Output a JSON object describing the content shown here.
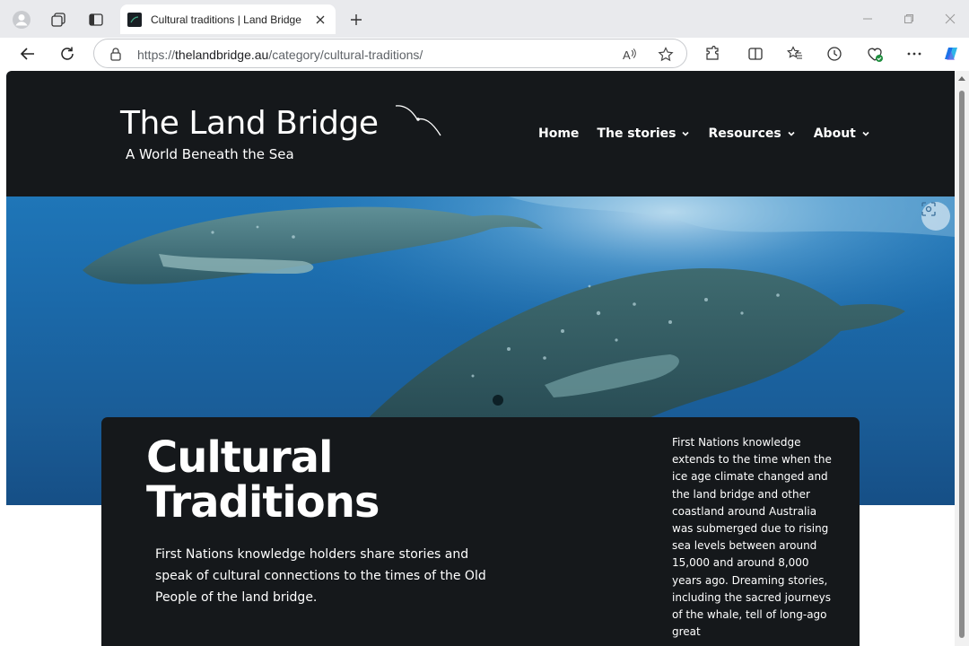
{
  "browser": {
    "tab_title": "Cultural traditions | Land Bridge",
    "url_prefix": "https://",
    "url_host": "thelandbridge.au",
    "url_path": "/category/cultural-traditions/"
  },
  "site": {
    "title": "The Land Bridge",
    "subtitle": "A World Beneath the Sea",
    "nav": [
      {
        "label": "Home",
        "has_dropdown": false
      },
      {
        "label": "The stories",
        "has_dropdown": true
      },
      {
        "label": "Resources",
        "has_dropdown": true
      },
      {
        "label": "About",
        "has_dropdown": true
      }
    ]
  },
  "card": {
    "title_line1": "Cultural",
    "title_line2": "Traditions",
    "lead": "First Nations knowledge holders share stories and speak of cultural connections to the times of the Old People of the land bridge.",
    "side_text": "First Nations knowledge extends to the time when the ice age climate changed and the land bridge and other coastland around Australia was submerged due to rising sea levels between around 15,000 and around 8,000 years ago. Dreaming stories, including the sacred journeys of the whale, tell of long-ago great"
  },
  "colors": {
    "header_bg": "#15181b",
    "ocean": "#1b69a9",
    "edge_accent": "#1a73e8"
  }
}
